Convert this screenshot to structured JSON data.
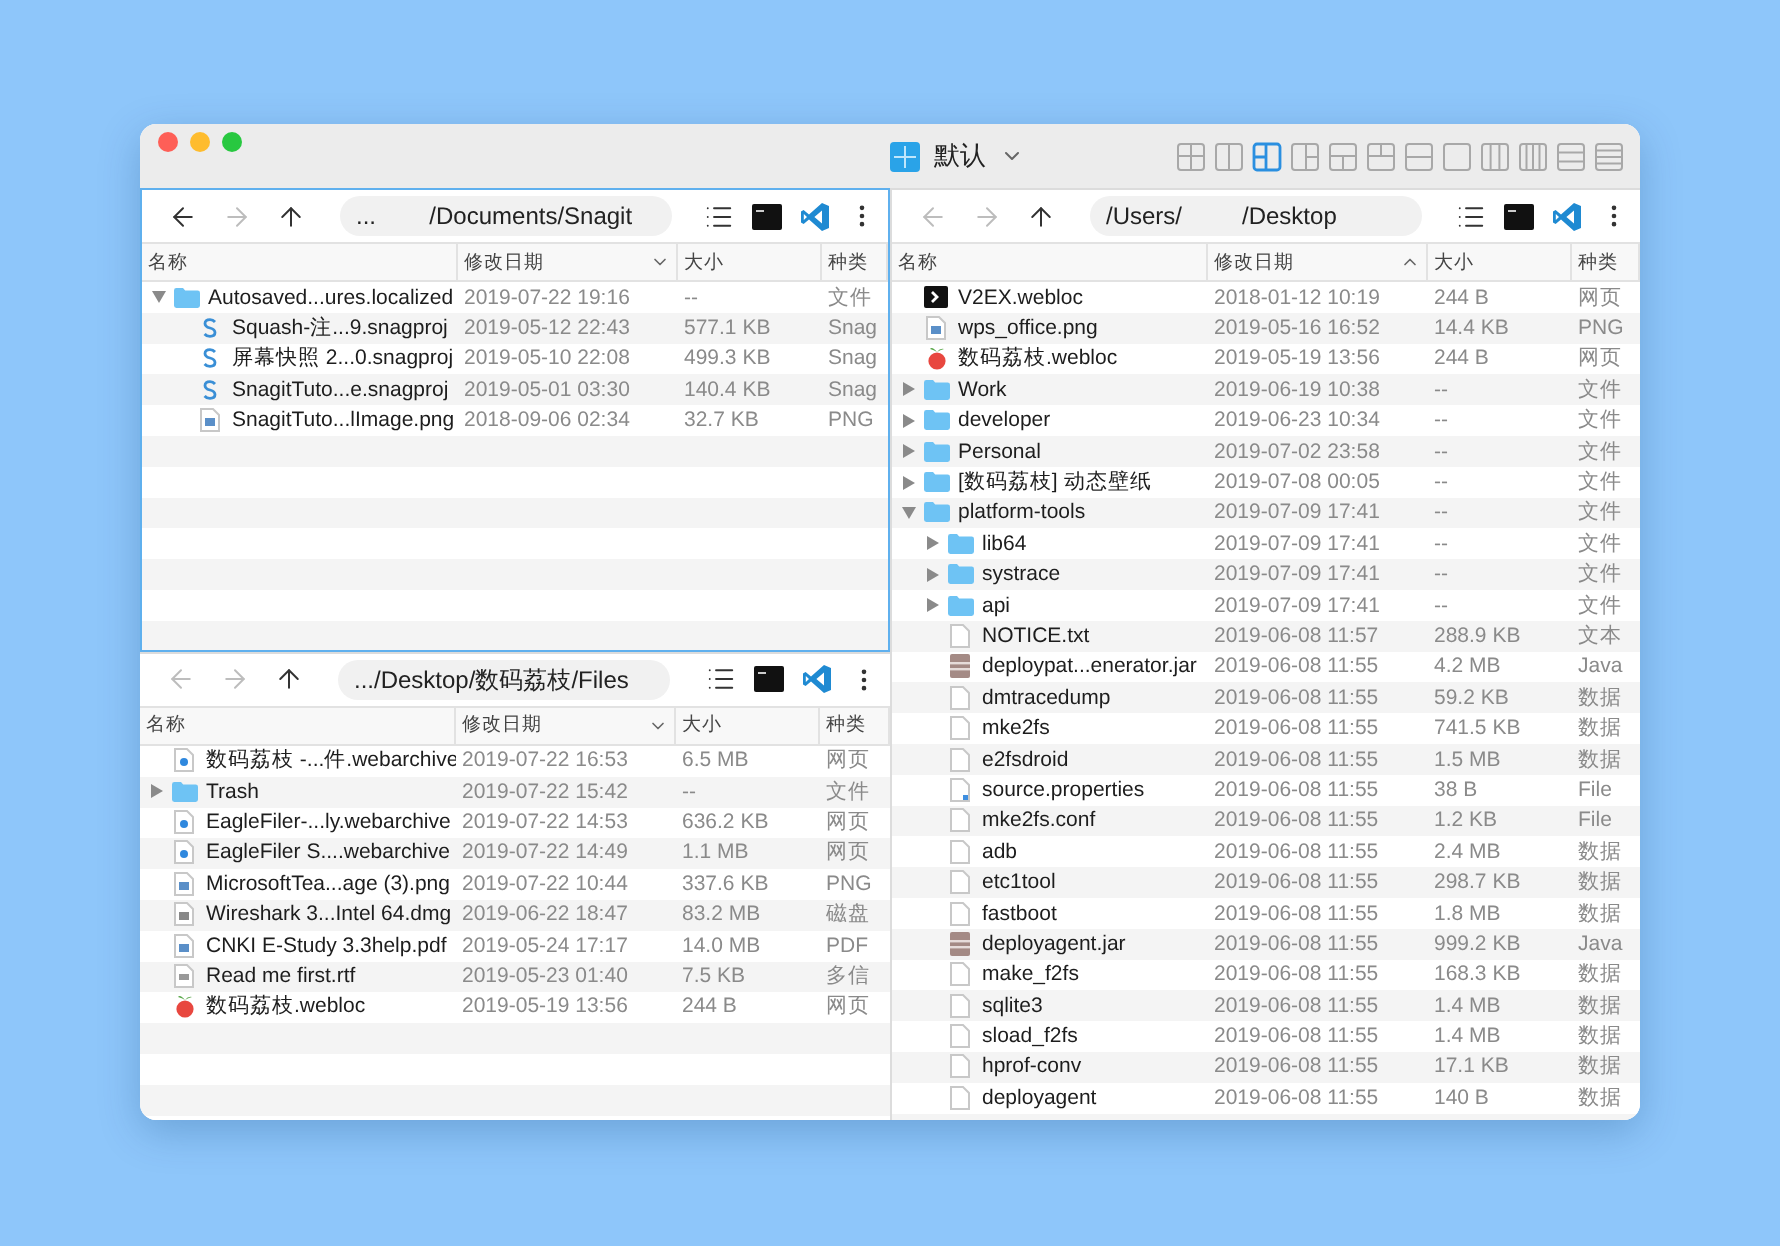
{
  "window": {
    "title": "默认",
    "layouts": [
      {
        "selected": false
      },
      {
        "selected": false
      },
      {
        "selected": true
      },
      {
        "selected": false
      },
      {
        "selected": false
      },
      {
        "selected": false
      },
      {
        "selected": false
      },
      {
        "selected": false
      },
      {
        "selected": false
      },
      {
        "selected": false
      },
      {
        "selected": false
      },
      {
        "selected": false
      }
    ]
  },
  "panes": [
    {
      "focused": true,
      "back": {
        "disabled": false
      },
      "forward": {
        "disabled": true
      },
      "up": {
        "disabled": false
      },
      "path": "...        /Documents/Snagit",
      "columns": [
        {
          "label": "名称"
        },
        {
          "label": "修改日期",
          "sorted": true,
          "ascending": false
        },
        {
          "label": "大小"
        },
        {
          "label": "种类"
        }
      ],
      "rows": [
        {
          "name": "Autosaved...ures.localized",
          "date": "2019-07-22 19:16",
          "size": "--",
          "file_type": "文件",
          "kind": "folder",
          "expanded": true,
          "children": [
            {
              "name": "Squash-注...9.snagproj",
              "date": "2019-05-12 22:43",
              "size": "577.1 KB",
              "file_type": "Snag",
              "kind": "snagit"
            },
            {
              "name": "屏幕快照 2...0.snagproj",
              "date": "2019-05-10 22:08",
              "size": "499.3 KB",
              "file_type": "Snag",
              "kind": "snagit"
            },
            {
              "name": "SnagitTuto...e.snagproj",
              "date": "2019-05-01 03:30",
              "size": "140.4 KB",
              "file_type": "Snag",
              "kind": "snagit"
            },
            {
              "name": "SnagitTuto...lImage.png",
              "date": "2018-09-06 02:34",
              "size": "32.7 KB",
              "file_type": "PNG",
              "kind": "image"
            }
          ]
        }
      ]
    },
    {
      "focused": false,
      "back": {
        "disabled": true
      },
      "forward": {
        "disabled": true
      },
      "up": {
        "disabled": false
      },
      "path": ".../Desktop/数码荔枝/Files",
      "columns": [
        {
          "label": "名称"
        },
        {
          "label": "修改日期",
          "sorted": true,
          "ascending": false
        },
        {
          "label": "大小"
        },
        {
          "label": "种类"
        }
      ],
      "rows": [
        {
          "name": "数码荔枝 -...件.webarchive",
          "date": "2019-07-22 16:53",
          "size": "6.5 MB",
          "file_type": "网页",
          "kind": "web"
        },
        {
          "name": "Trash",
          "date": "2019-07-22 15:42",
          "size": "--",
          "file_type": "文件",
          "kind": "folder",
          "expanded": false
        },
        {
          "name": "EagleFiler-...ly.webarchive",
          "date": "2019-07-22 14:53",
          "size": "636.2 KB",
          "file_type": "网页",
          "kind": "web"
        },
        {
          "name": "EagleFiler S....webarchive",
          "date": "2019-07-22 14:49",
          "size": "1.1 MB",
          "file_type": "网页",
          "kind": "web"
        },
        {
          "name": "MicrosoftTea...age (3).png",
          "date": "2019-07-22 10:44",
          "size": "337.6 KB",
          "file_type": "PNG",
          "kind": "image"
        },
        {
          "name": "Wireshark 3...Intel 64.dmg",
          "date": "2019-06-22 18:47",
          "size": "83.2 MB",
          "file_type": "磁盘",
          "kind": "disk"
        },
        {
          "name": "CNKI E-Study 3.3help.pdf",
          "date": "2019-05-24 17:17",
          "size": "14.0 MB",
          "file_type": "PDF",
          "kind": "image"
        },
        {
          "name": "Read me first.rtf",
          "date": "2019-05-23 01:40",
          "size": "7.5 KB",
          "file_type": "多信",
          "kind": "text"
        },
        {
          "name": "数码荔枝.webloc",
          "date": "2019-05-19 13:56",
          "size": "244 B",
          "file_type": "网页",
          "kind": "fruit"
        }
      ]
    },
    {
      "focused": false,
      "back": {
        "disabled": true
      },
      "forward": {
        "disabled": true
      },
      "up": {
        "disabled": false
      },
      "path": "/Users/         /Desktop",
      "columns": [
        {
          "label": "名称"
        },
        {
          "label": "修改日期",
          "sorted": true,
          "ascending": true
        },
        {
          "label": "大小"
        },
        {
          "label": "种类"
        }
      ],
      "rows": [
        {
          "name": "V2EX.webloc",
          "date": "2018-01-12 10:19",
          "size": "244 B",
          "file_type": "网页",
          "kind": "terminal"
        },
        {
          "name": "wps_office.png",
          "date": "2019-05-16 16:52",
          "size": "14.4 KB",
          "file_type": "PNG",
          "kind": "image"
        },
        {
          "name": "数码荔枝.webloc",
          "date": "2019-05-19 13:56",
          "size": "244 B",
          "file_type": "网页",
          "kind": "fruit"
        },
        {
          "name": "Work",
          "date": "2019-06-19 10:38",
          "size": "--",
          "file_type": "文件",
          "kind": "folder",
          "expanded": false
        },
        {
          "name": "developer",
          "date": "2019-06-23 10:34",
          "size": "--",
          "file_type": "文件",
          "kind": "folder",
          "expanded": false
        },
        {
          "name": "Personal",
          "date": "2019-07-02 23:58",
          "size": "--",
          "file_type": "文件",
          "kind": "folder",
          "expanded": false
        },
        {
          "name": "[数码荔枝] 动态壁纸",
          "date": "2019-07-08 00:05",
          "size": "--",
          "file_type": "文件",
          "kind": "folder",
          "expanded": false
        },
        {
          "name": "platform-tools",
          "date": "2019-07-09 17:41",
          "size": "--",
          "file_type": "文件",
          "kind": "folder",
          "expanded": true,
          "children": [
            {
              "name": "lib64",
              "date": "2019-07-09 17:41",
              "size": "--",
              "file_type": "文件",
              "kind": "folder",
              "expanded": false
            },
            {
              "name": "systrace",
              "date": "2019-07-09 17:41",
              "size": "--",
              "file_type": "文件",
              "kind": "folder",
              "expanded": false
            },
            {
              "name": "api",
              "date": "2019-07-09 17:41",
              "size": "--",
              "file_type": "文件",
              "kind": "folder",
              "expanded": false
            },
            {
              "name": "NOTICE.txt",
              "date": "2019-06-08 11:57",
              "size": "288.9 KB",
              "file_type": "文本",
              "kind": "file"
            },
            {
              "name": "deploypat...enerator.jar",
              "date": "2019-06-08 11:55",
              "size": "4.2 MB",
              "file_type": "Java",
              "kind": "jar"
            },
            {
              "name": "dmtracedump",
              "date": "2019-06-08 11:55",
              "size": "59.2 KB",
              "file_type": "数据",
              "kind": "file"
            },
            {
              "name": "mke2fs",
              "date": "2019-06-08 11:55",
              "size": "741.5 KB",
              "file_type": "数据",
              "kind": "file"
            },
            {
              "name": "e2fsdroid",
              "date": "2019-06-08 11:55",
              "size": "1.5 MB",
              "file_type": "数据",
              "kind": "file"
            },
            {
              "name": "source.properties",
              "date": "2019-06-08 11:55",
              "size": "38 B",
              "file_type": "File",
              "kind": "properties"
            },
            {
              "name": "mke2fs.conf",
              "date": "2019-06-08 11:55",
              "size": "1.2 KB",
              "file_type": "File",
              "kind": "file"
            },
            {
              "name": "adb",
              "date": "2019-06-08 11:55",
              "size": "2.4 MB",
              "file_type": "数据",
              "kind": "file"
            },
            {
              "name": "etc1tool",
              "date": "2019-06-08 11:55",
              "size": "298.7 KB",
              "file_type": "数据",
              "kind": "file"
            },
            {
              "name": "fastboot",
              "date": "2019-06-08 11:55",
              "size": "1.8 MB",
              "file_type": "数据",
              "kind": "file"
            },
            {
              "name": "deployagent.jar",
              "date": "2019-06-08 11:55",
              "size": "999.2 KB",
              "file_type": "Java",
              "kind": "jar"
            },
            {
              "name": "make_f2fs",
              "date": "2019-06-08 11:55",
              "size": "168.3 KB",
              "file_type": "数据",
              "kind": "file"
            },
            {
              "name": "sqlite3",
              "date": "2019-06-08 11:55",
              "size": "1.4 MB",
              "file_type": "数据",
              "kind": "file"
            },
            {
              "name": "sload_f2fs",
              "date": "2019-06-08 11:55",
              "size": "1.4 MB",
              "file_type": "数据",
              "kind": "file"
            },
            {
              "name": "hprof-conv",
              "date": "2019-06-08 11:55",
              "size": "17.1 KB",
              "file_type": "数据",
              "kind": "file"
            },
            {
              "name": "deployagent",
              "date": "2019-06-08 11:55",
              "size": "140 B",
              "file_type": "数据",
              "kind": "file"
            }
          ]
        }
      ]
    }
  ]
}
